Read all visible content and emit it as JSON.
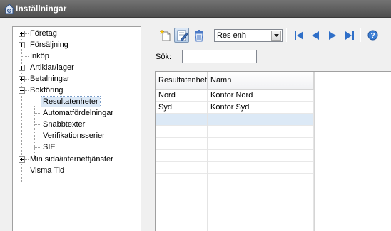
{
  "window": {
    "title": "Inställningar",
    "icon": "settings-house-icon"
  },
  "tree": {
    "items": [
      {
        "label": "Företag",
        "expander": "plus"
      },
      {
        "label": "Försäljning",
        "expander": "plus"
      },
      {
        "label": "Inköp",
        "expander": "none"
      },
      {
        "label": "Artiklar/lager",
        "expander": "plus"
      },
      {
        "label": "Betalningar",
        "expander": "plus"
      },
      {
        "label": "Bokföring",
        "expander": "minus"
      },
      {
        "label": "Resultatenheter",
        "expander": "none",
        "selected": true
      },
      {
        "label": "Automatfördelningar",
        "expander": "none"
      },
      {
        "label": "Snabbtexter",
        "expander": "none"
      },
      {
        "label": "Verifikationsserier",
        "expander": "none"
      },
      {
        "label": "SIE",
        "expander": "none"
      },
      {
        "label": "Min sida/internettjänster",
        "expander": "plus"
      },
      {
        "label": "Visma Tid",
        "expander": "none"
      }
    ]
  },
  "toolbar": {
    "buttons": [
      {
        "name": "new-icon"
      },
      {
        "name": "edit-icon",
        "active": true
      },
      {
        "name": "delete-icon"
      },
      {
        "name": "first-icon"
      },
      {
        "name": "previous-icon"
      },
      {
        "name": "next-icon"
      },
      {
        "name": "last-icon"
      },
      {
        "name": "help-icon"
      }
    ],
    "select_value": "Res enh"
  },
  "search": {
    "label": "Sök:",
    "value": ""
  },
  "grid": {
    "columns": [
      "Resultatenhet",
      "Namn"
    ],
    "rows": [
      [
        "Nord",
        "Kontor Nord"
      ],
      [
        "Syd",
        "Kontor Syd"
      ],
      [
        "",
        ""
      ],
      [
        "",
        ""
      ],
      [
        "",
        ""
      ],
      [
        "",
        ""
      ],
      [
        "",
        ""
      ],
      [
        "",
        ""
      ],
      [
        "",
        ""
      ],
      [
        "",
        ""
      ],
      [
        "",
        ""
      ],
      [
        "",
        ""
      ]
    ],
    "selected_row_index": 2
  },
  "colors": {
    "titlebar": "#5e5e5e",
    "selection": "#dce9f6",
    "nav_blue": "#2f6fc8",
    "delete_blue": "#4b79c6"
  }
}
